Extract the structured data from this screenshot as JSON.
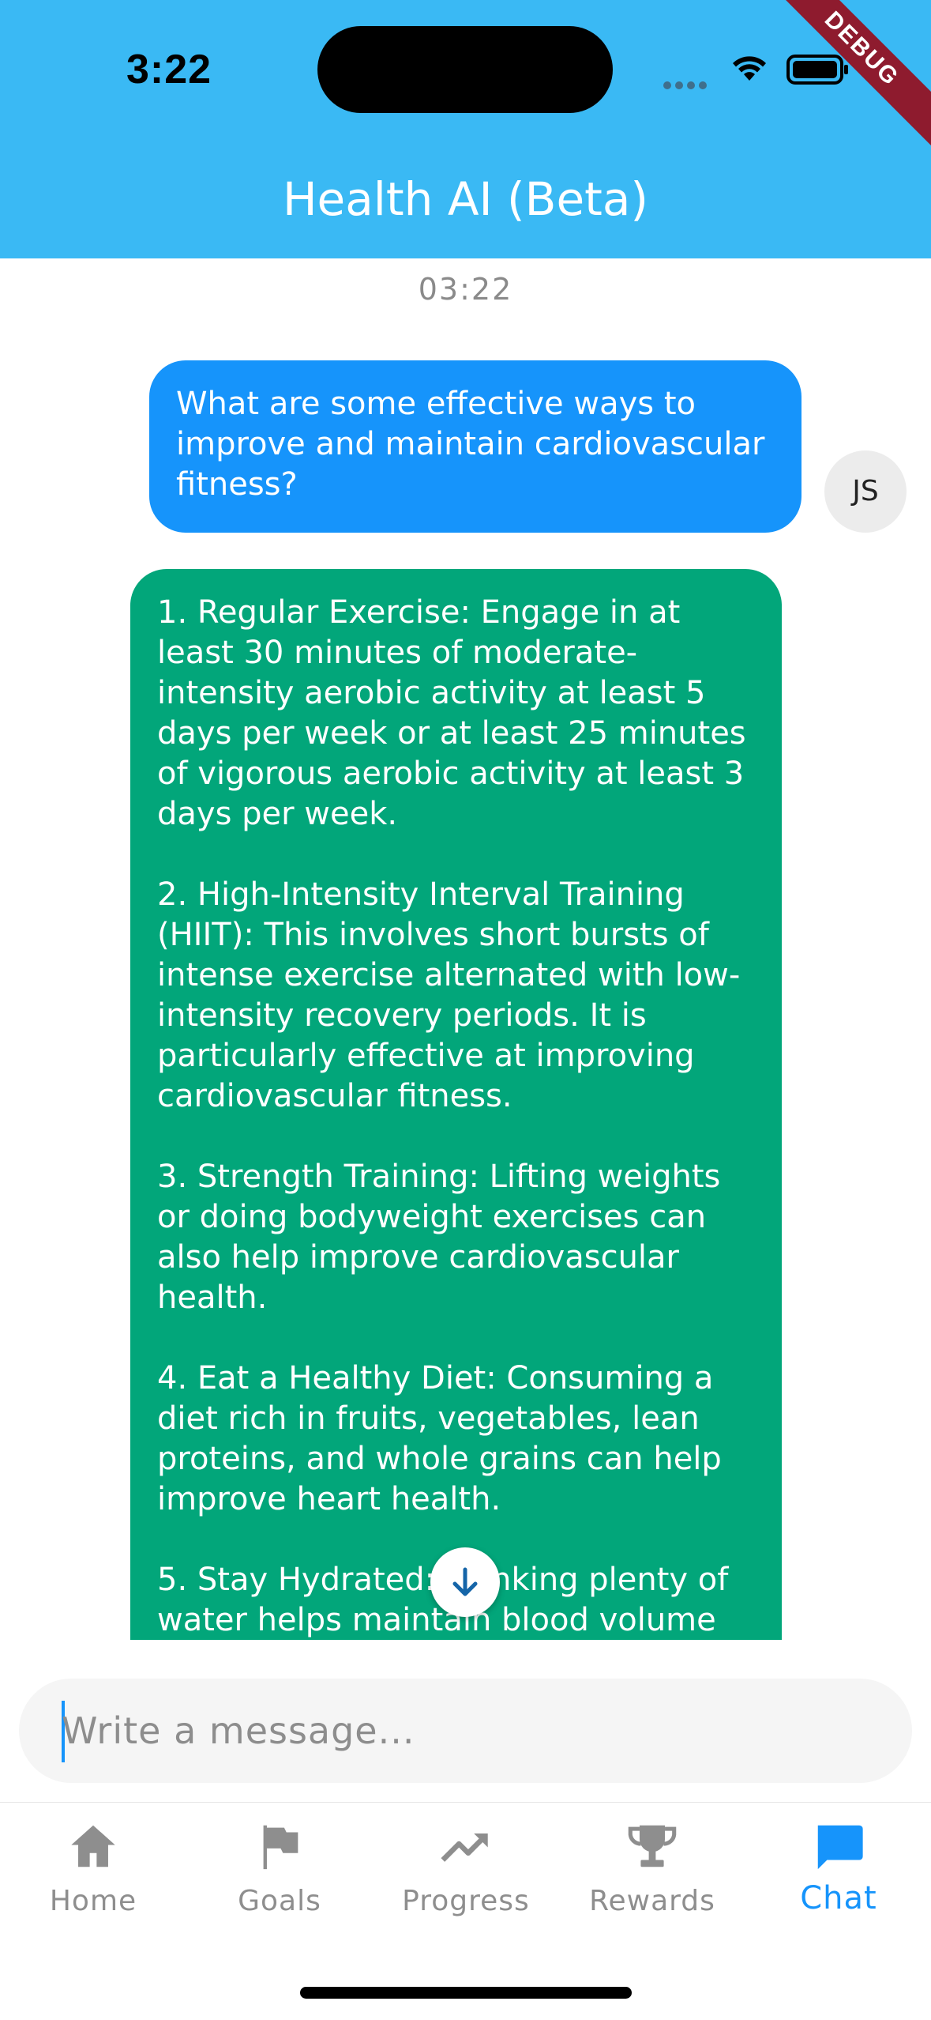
{
  "status_bar": {
    "time": "3:22"
  },
  "debug_banner": "DEBUG",
  "header": {
    "title": "Health AI (Beta)"
  },
  "chat": {
    "timestamp": "03:22",
    "user_message": {
      "text": "What are some effective ways to improve and maintain cardiovascular fitness?",
      "avatar_initials": "JS"
    },
    "bot_message": {
      "text": "1. Regular Exercise: Engage in at least 30 minutes of moderate-intensity aerobic activity at least 5 days per week or at least 25 minutes of vigorous aerobic activity at least 3 days per week.\n\n2. High-Intensity Interval Training (HIIT): This involves short bursts of intense exercise alternated with low-intensity recovery periods. It is particularly effective at improving cardiovascular fitness.\n\n3. Strength Training: Lifting weights or doing bodyweight exercises can also help improve cardiovascular health.\n\n4. Eat a Healthy Diet: Consuming a diet rich in fruits, vegetables, lean proteins, and whole grains can help improve heart health.\n\n5. Stay Hydrated: Drinking plenty of water helps maintain blood volume and allows your cardiovascular system"
    }
  },
  "composer": {
    "placeholder": "Write a message..."
  },
  "nav": {
    "items": [
      {
        "label": "Home",
        "icon": "home-icon"
      },
      {
        "label": "Goals",
        "icon": "flag-icon"
      },
      {
        "label": "Progress",
        "icon": "trending-up-icon"
      },
      {
        "label": "Rewards",
        "icon": "trophy-icon"
      },
      {
        "label": "Chat",
        "icon": "chat-icon",
        "active": true
      }
    ]
  },
  "colors": {
    "header": "#3AB9F4",
    "user_bubble": "#1694FB",
    "bot_bubble": "#02A67A",
    "active_nav": "#1694FB",
    "inactive_nav": "#8E8E8E"
  }
}
